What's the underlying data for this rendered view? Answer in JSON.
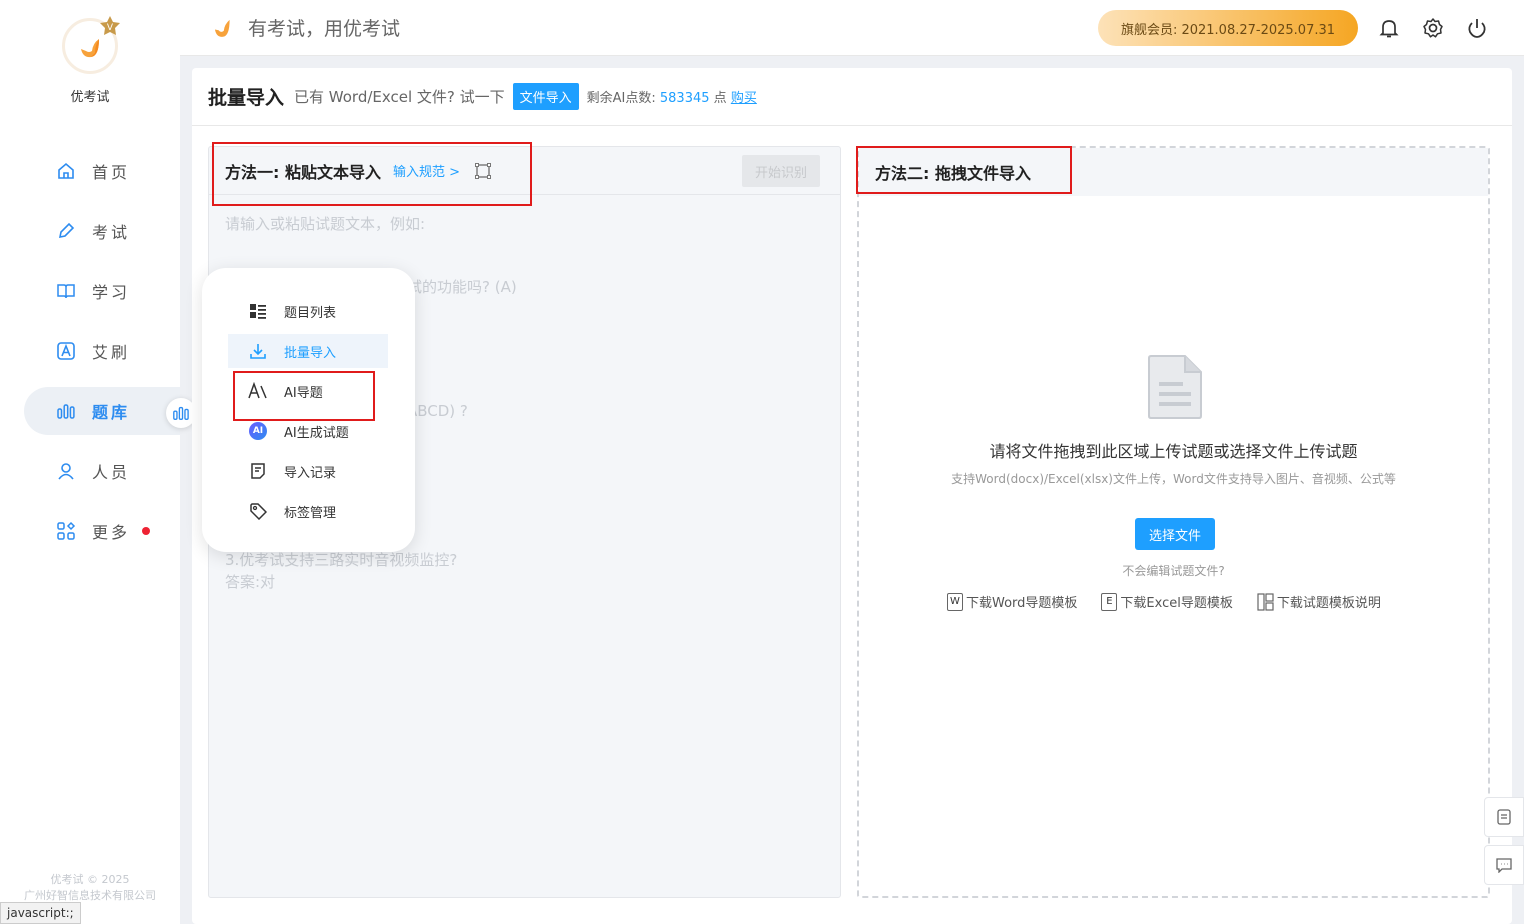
{
  "brand": {
    "name": "优考试",
    "slogan": "有考试，用优考试"
  },
  "sidebar": {
    "items": [
      {
        "label": "首页",
        "icon": "home-icon"
      },
      {
        "label": "考试",
        "icon": "pen-icon"
      },
      {
        "label": "学习",
        "icon": "book-icon"
      },
      {
        "label": "艾刷",
        "icon": "a-badge-icon"
      },
      {
        "label": "题库",
        "icon": "bar-chart-icon",
        "active": true
      },
      {
        "label": "人员",
        "icon": "user-icon"
      },
      {
        "label": "更多",
        "icon": "grid-icon",
        "badge": true
      }
    ],
    "footer_line1": "优考试 © 2025",
    "footer_line2": "广州好智信息技术有限公司"
  },
  "status_bar": "javascript:;",
  "header": {
    "vip_label": "旗舰会员: 2021.08.27-2025.07.31"
  },
  "page": {
    "title": "批量导入",
    "hint": "已有 Word/Excel 文件? 试一下",
    "file_import_btn": "文件导入",
    "ai_points_label": "剩余AI点数:",
    "ai_points_value": "583345",
    "ai_points_unit": "点",
    "buy_link": "购买"
  },
  "method1": {
    "title": "方法一: 粘贴文本导入",
    "rule_link": "输入规范 >",
    "start_btn": "开始识别",
    "placeholder_lines": [
      "请输入或粘贴试题文本，例如:",
      "试的功能吗? (A)",
      "ABCD) ?",
      "3.优考试支持三路实时音视频监控?",
      "答案:对"
    ]
  },
  "method2": {
    "title": "方法二: 拖拽文件导入",
    "drop_title": "请将文件拖拽到此区域上传试题或选择文件上传试题",
    "drop_sub": "支持Word(docx)/Excel(xlsx)文件上传，Word文件支持导入图片、音视频、公式等",
    "choose_btn": "选择文件",
    "no_edit": "不会编辑试题文件?",
    "dl_word": "下载Word导题模板",
    "dl_excel": "下载Excel导题模板",
    "dl_guide": "下载试题模板说明",
    "word_icon_letter": "W",
    "excel_icon_letter": "E"
  },
  "popup_menu": {
    "items": [
      {
        "label": "题目列表",
        "icon": "list-icon"
      },
      {
        "label": "批量导入",
        "icon": "download-icon",
        "active": true
      },
      {
        "label": "AI导题",
        "icon": "ai-import-icon"
      },
      {
        "label": "AI生成试题",
        "icon": "ai-badge-icon",
        "badge_text": "AI"
      },
      {
        "label": "导入记录",
        "icon": "record-icon"
      },
      {
        "label": "标签管理",
        "icon": "tag-icon"
      }
    ]
  },
  "colors": {
    "accent": "#1e9fff",
    "nav_accent": "#2d8cf0",
    "highlight_box": "#e01b1b",
    "vip_gradient_end": "#f5a623"
  }
}
